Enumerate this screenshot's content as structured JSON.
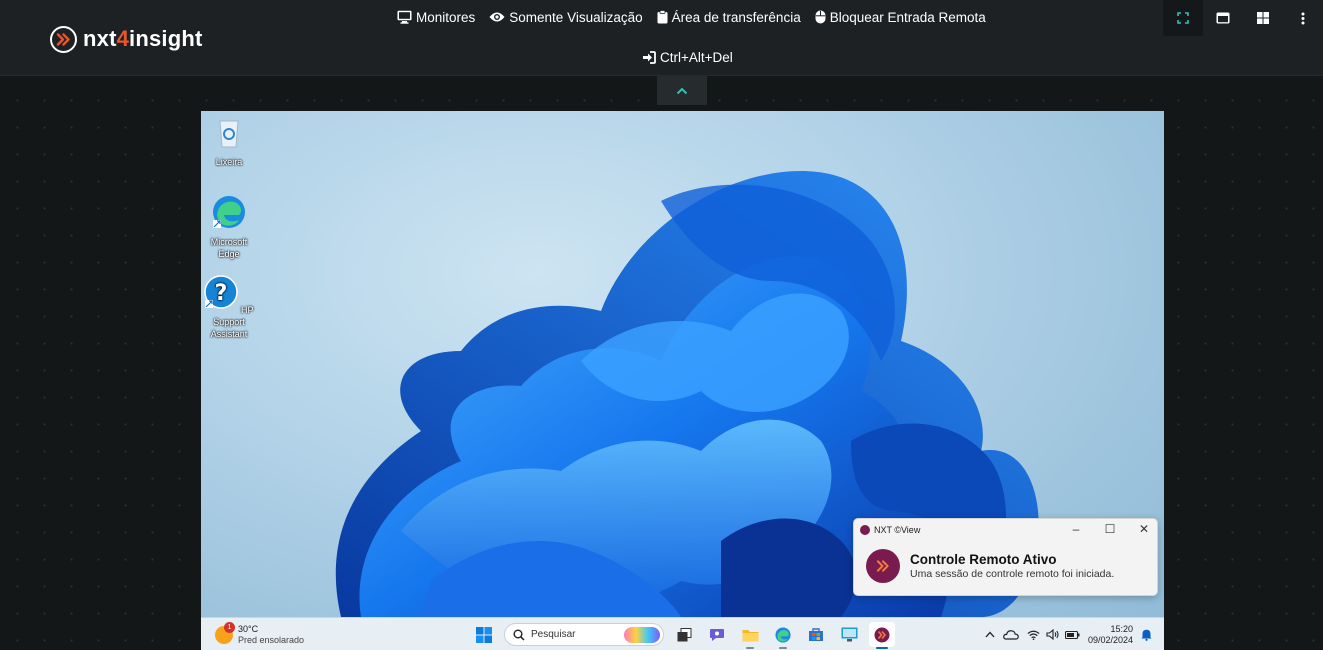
{
  "brand": {
    "prefix": "nxt",
    "accent": "4",
    "suffix": "insight"
  },
  "toolbar": {
    "items": [
      {
        "label": "Monitores",
        "icon": "monitor-icon"
      },
      {
        "label": "Somente Visualização",
        "icon": "eye-icon"
      },
      {
        "label": "Área de transferência",
        "icon": "clipboard-icon"
      },
      {
        "label": "Bloquear Entrada Remota",
        "icon": "mouse-icon"
      }
    ],
    "ctrl_alt_del": {
      "label": "Ctrl+Alt+Del",
      "icon": "sign-in-icon"
    },
    "right_tools": [
      "fullscreen-icon",
      "window-icon",
      "windows-icon",
      "more-vertical-icon"
    ]
  },
  "desktop": {
    "icons": [
      {
        "label": "Lixeira"
      },
      {
        "label": "Microsoft Edge"
      },
      {
        "label": "HP Support Assistant"
      }
    ],
    "notification": {
      "app": "NXT ©View",
      "title": "Controle Remoto Ativo",
      "body": "Uma sessão de controle remoto foi iniciada."
    },
    "taskbar": {
      "weather": {
        "temp": "30°C",
        "condition": "Pred ensolarado",
        "badge": "1"
      },
      "search_placeholder": "Pesquisar",
      "clock": {
        "time": "15:20",
        "date": "09/02/2024"
      }
    }
  },
  "colors": {
    "accent_teal": "#2ec4b6",
    "brand_orange": "#e4572e",
    "toolbar_bg": "#1d2123",
    "app_magenta": "#7a1b4f"
  }
}
